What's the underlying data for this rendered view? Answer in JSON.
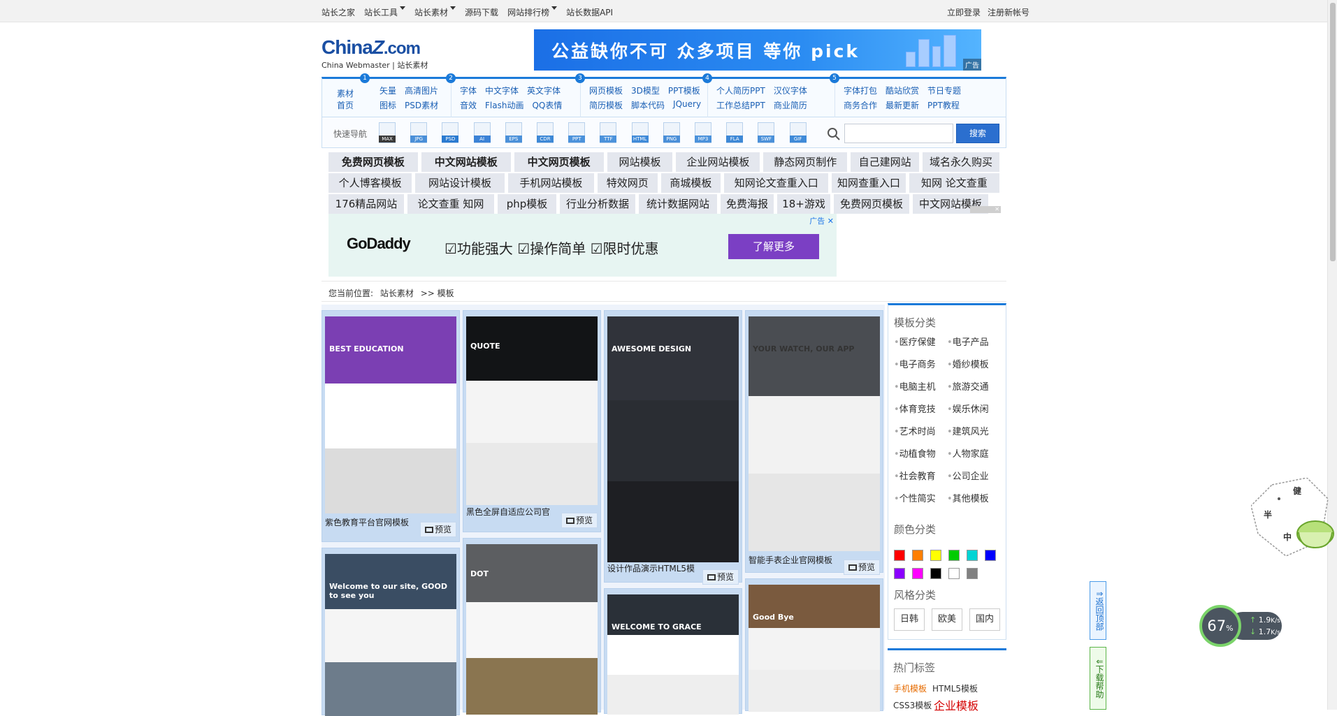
{
  "topbar": {
    "left": [
      {
        "label": "站长之家",
        "dropdown": false
      },
      {
        "label": "站长工具",
        "dropdown": true
      },
      {
        "label": "站长素材",
        "dropdown": true
      },
      {
        "label": "源码下载",
        "dropdown": false
      },
      {
        "label": "网站排行榜",
        "dropdown": true
      },
      {
        "label": "站长数据API",
        "dropdown": false
      }
    ],
    "right": [
      "立即登录",
      "注册新帐号"
    ]
  },
  "logo": {
    "main_a": "China",
    "main_z": "Z",
    "main_com": ".com",
    "sub": "China Webmaster | 站长素材"
  },
  "top_ad": {
    "text": "公益缺你不可  众多项目  等你 pick",
    "tag": "广告"
  },
  "catnav": {
    "home": [
      "素材",
      "首页"
    ],
    "sections": [
      {
        "num": "1",
        "row1": [
          "矢量",
          "高清图片"
        ],
        "row2": [
          "图标",
          "PSD素材"
        ]
      },
      {
        "num": "2",
        "row1": [
          "字体",
          "中文字体",
          "英文字体"
        ],
        "row2": [
          "音效",
          "Flash动画",
          "QQ表情"
        ]
      },
      {
        "num": "3",
        "row1": [
          "网页模板",
          "3D模型",
          "PPT模板"
        ],
        "row2": [
          "简历模板",
          "脚本代码",
          "JQuery"
        ]
      },
      {
        "num": "4",
        "row1": [
          "个人简历PPT",
          "汉仪字体"
        ],
        "row2": [
          "工作总结PPT",
          "商业简历"
        ]
      },
      {
        "num": "5",
        "row1": [
          "字体打包",
          "酷站欣赏",
          "节日专题"
        ],
        "row2": [
          "商务合作",
          "最新更新",
          "PPT教程"
        ]
      }
    ]
  },
  "quick_nav": {
    "label": "快速导航",
    "icons": [
      {
        "tag": "MAX",
        "color": "#3a3a3a"
      },
      {
        "tag": "JPG",
        "color": "#4a8fd8"
      },
      {
        "tag": "PSD",
        "color": "#2a7ad0"
      },
      {
        "tag": "AI",
        "color": "#3b82d6"
      },
      {
        "tag": "EPS",
        "color": "#4a90d9"
      },
      {
        "tag": "CDR",
        "color": "#3d88d6"
      },
      {
        "tag": "PPT",
        "color": "#4b92db"
      },
      {
        "tag": "TTF",
        "color": "#4b92db"
      },
      {
        "tag": "HTML",
        "color": "#3f8ad8"
      },
      {
        "tag": "PNG",
        "color": "#4a8fd8"
      },
      {
        "tag": "MP3",
        "color": "#4b92db"
      },
      {
        "tag": "FLA",
        "color": "#3d88d6"
      },
      {
        "tag": "SWF",
        "color": "#4a90d9"
      },
      {
        "tag": "GIF",
        "color": "#3f8ad8"
      }
    ],
    "search_value": "",
    "search_button": "搜索"
  },
  "hotlinks": [
    [
      {
        "t": "免费网页模板",
        "b": true
      },
      {
        "t": "中文网站模板",
        "b": true
      },
      {
        "t": "中文网页模板",
        "b": true
      },
      {
        "t": "网站模板",
        "b": false
      },
      {
        "t": "企业网站模板",
        "b": false
      },
      {
        "t": "静态网页制作",
        "b": false
      },
      {
        "t": "自己建网站",
        "b": false
      },
      {
        "t": "域名永久购买",
        "b": false
      }
    ],
    [
      {
        "t": "个人博客模板",
        "b": false
      },
      {
        "t": "网站设计模板",
        "b": false
      },
      {
        "t": "手机网站模板",
        "b": false
      },
      {
        "t": "特效网页",
        "b": false
      },
      {
        "t": "商城模板",
        "b": false
      },
      {
        "t": "知网论文查重入口",
        "b": false
      },
      {
        "t": "知网查重入口",
        "b": false
      },
      {
        "t": "知网  论文查重",
        "b": false
      }
    ],
    [
      {
        "t": "176精品网站",
        "b": false
      },
      {
        "t": "论文查重  知网",
        "b": false
      },
      {
        "t": "php模板",
        "b": false
      },
      {
        "t": "行业分析数据",
        "b": false
      },
      {
        "t": "统计数据网站",
        "b": false
      },
      {
        "t": "免费海报",
        "b": false
      },
      {
        "t": "18+游戏",
        "b": false
      },
      {
        "t": "免费网页模板",
        "b": false
      },
      {
        "t": "中文网站模板",
        "b": false
      }
    ]
  ],
  "godaddy_ad": {
    "brand": "GoDaddy",
    "features": "☑功能强大  ☑操作简单  ☑限时优惠",
    "cta": "了解更多",
    "label": "广告 ✕"
  },
  "breadcrumb": {
    "prefix": "您当前位置:",
    "items": [
      "站长素材",
      ">> 模板"
    ]
  },
  "templates": [
    {
      "caption": "紫色教育平台官网模板",
      "preview": "预览",
      "theme": "edu",
      "title": "BEST EDUCATION"
    },
    {
      "caption": "黑色全屏自适应公司官",
      "preview": "预览",
      "theme": "quote",
      "title": "QUOTE"
    },
    {
      "caption": "设计作品演示HTML5模",
      "preview": "预览",
      "theme": "laptop",
      "title": "AWESOME DESIGN"
    },
    {
      "caption": "智能手表企业官网模板",
      "preview": "预览",
      "theme": "watch",
      "title": "YOUR WATCH, OUR APP"
    },
    {
      "caption": "",
      "preview": "",
      "theme": "corp",
      "title": "Welcome to our site, GOOD to see you"
    },
    {
      "caption": "",
      "preview": "",
      "theme": "dot",
      "title": "DOT"
    },
    {
      "caption": "",
      "preview": "",
      "theme": "grace",
      "title": "WELCOME TO GRACE"
    },
    {
      "caption": "",
      "preview": "",
      "theme": "fashion",
      "title": "Good Bye"
    }
  ],
  "sidebar": {
    "cat_title": "模板分类",
    "cats": [
      "医疗保健",
      "电子产品",
      "电子商务",
      "婚纱模板",
      "电脑主机",
      "旅游交通",
      "体育竞技",
      "娱乐休闲",
      "艺术时尚",
      "建筑风光",
      "动植食物",
      "人物家庭",
      "社会教育",
      "公司企业",
      "个性简实",
      "其他模板"
    ],
    "color_title": "颜色分类",
    "colors": [
      "#ff0000",
      "#ff7f00",
      "#ffff00",
      "#00cc00",
      "#00d4d4",
      "#0000ff",
      "#8b00ff",
      "#ff00ff",
      "#000000",
      "#ffffff",
      "#808080"
    ],
    "style_title": "风格分类",
    "styles": [
      "日韩",
      "欧美",
      "国内"
    ],
    "tag_title": "热门标签",
    "tags": [
      {
        "t": "手机模板",
        "color": "#e66b00",
        "size": "12"
      },
      {
        "t": "HTML5模板",
        "color": "#333333",
        "size": "12"
      },
      {
        "t": "CSS3模板",
        "color": "#333333",
        "size": "12"
      },
      {
        "t": "企业模板",
        "color": "#d40000",
        "size": "16"
      }
    ]
  },
  "floaters": {
    "back_top": "返回顶部",
    "help": "下载帮助"
  },
  "speed": {
    "percent": "67",
    "up": "1.9",
    "down": "1.7",
    "unit": "K/s"
  },
  "deco": {
    "chars": [
      "健",
      "半",
      "中"
    ]
  }
}
